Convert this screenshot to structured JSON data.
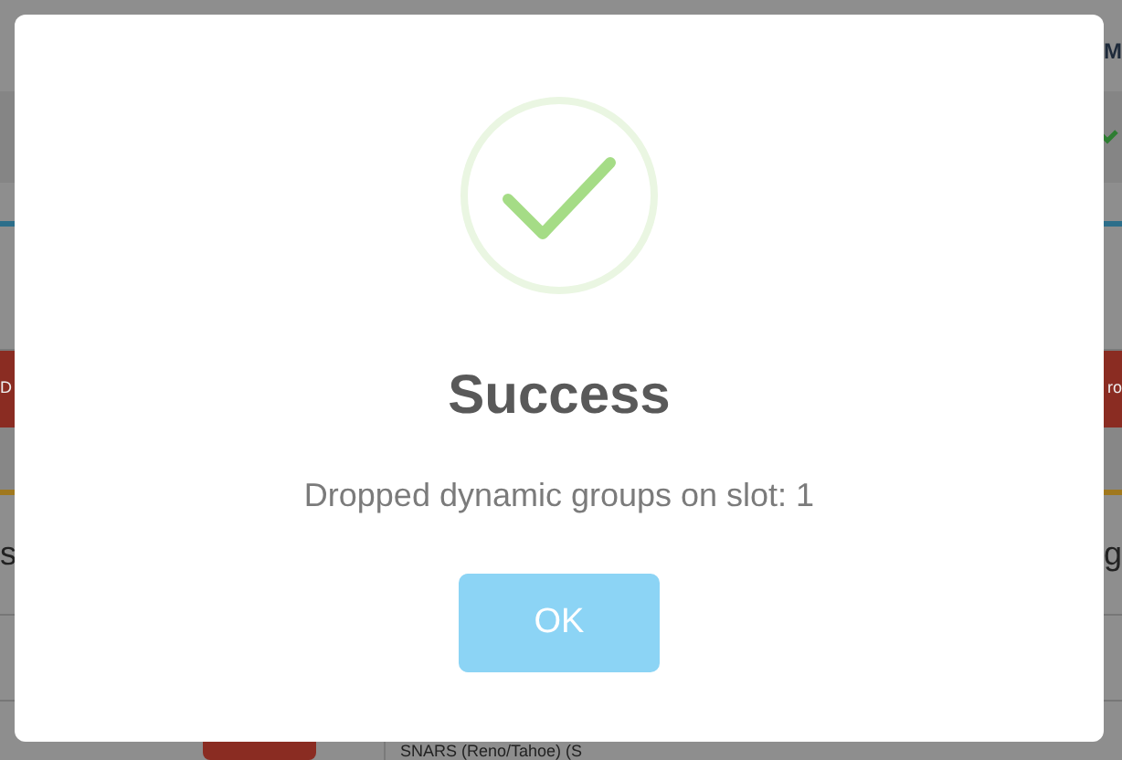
{
  "background": {
    "top_right_text": "M",
    "left_button_text": "D",
    "right_button_text": "ro",
    "left_text": "s",
    "right_text": "g",
    "bottom_cell_text": "SNARS (Reno/Tahoe) (S"
  },
  "dialog": {
    "kind": "success",
    "title": "Success",
    "message": "Dropped dynamic groups on slot: 1",
    "button": "OK"
  }
}
